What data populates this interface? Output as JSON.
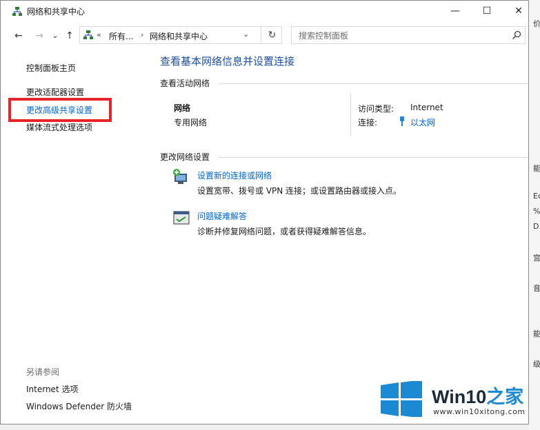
{
  "window": {
    "title": "网络和共享中心",
    "controls": {
      "minimize": "—",
      "maximize": "☐",
      "close": "✕"
    }
  },
  "nav": {
    "back": "←",
    "forward": "→",
    "recent": "⌄",
    "up": "↑"
  },
  "address": {
    "overflow": "«",
    "crumbs": [
      "所有...",
      "网络和共享中心"
    ],
    "separator": "›",
    "dropdown": "⌄",
    "refresh": "↻"
  },
  "search": {
    "placeholder": "搜索控制面板"
  },
  "sidebar": {
    "items": [
      {
        "label": "控制面板主页"
      },
      {
        "label": "更改适配器设置"
      },
      {
        "label": "更改高级共享设置"
      },
      {
        "label": "媒体流式处理选项"
      }
    ],
    "see_also": {
      "heading": "另请参阅",
      "items": [
        {
          "label": "Internet 选项"
        },
        {
          "label": "Windows Defender 防火墙"
        }
      ]
    }
  },
  "main": {
    "title": "查看基本网络信息并设置连接",
    "active_networks": {
      "heading": "查看活动网络",
      "network_name": "网络",
      "network_profile": "专用网络",
      "access_type_label": "访问类型:",
      "access_type_value": "Internet",
      "connections_label": "连接:",
      "connections_value": "以太网"
    },
    "change_settings": {
      "heading": "更改网络设置",
      "tasks": [
        {
          "link": "设置新的连接或网络",
          "desc": "设置宽带、拨号或 VPN 连接；或设置路由器或接入点。"
        },
        {
          "link": "问题疑难解答",
          "desc": "诊断并修复网络问题，或者获得疑难解答信息。"
        }
      ]
    }
  },
  "background_fragments": [
    "价",
    "能",
    "Ec",
    "%",
    "D",
    "宫",
    "音",
    "能",
    "级"
  ],
  "watermark": {
    "brand_latin": "Win10",
    "brand_cjk": "之家",
    "url": "www.win10xitong.com"
  },
  "colors": {
    "link": "#0066cc",
    "title_blue": "#1f4e9c",
    "highlight_red": "#e8232a",
    "win_logo_blue": "#1b8ad3"
  }
}
